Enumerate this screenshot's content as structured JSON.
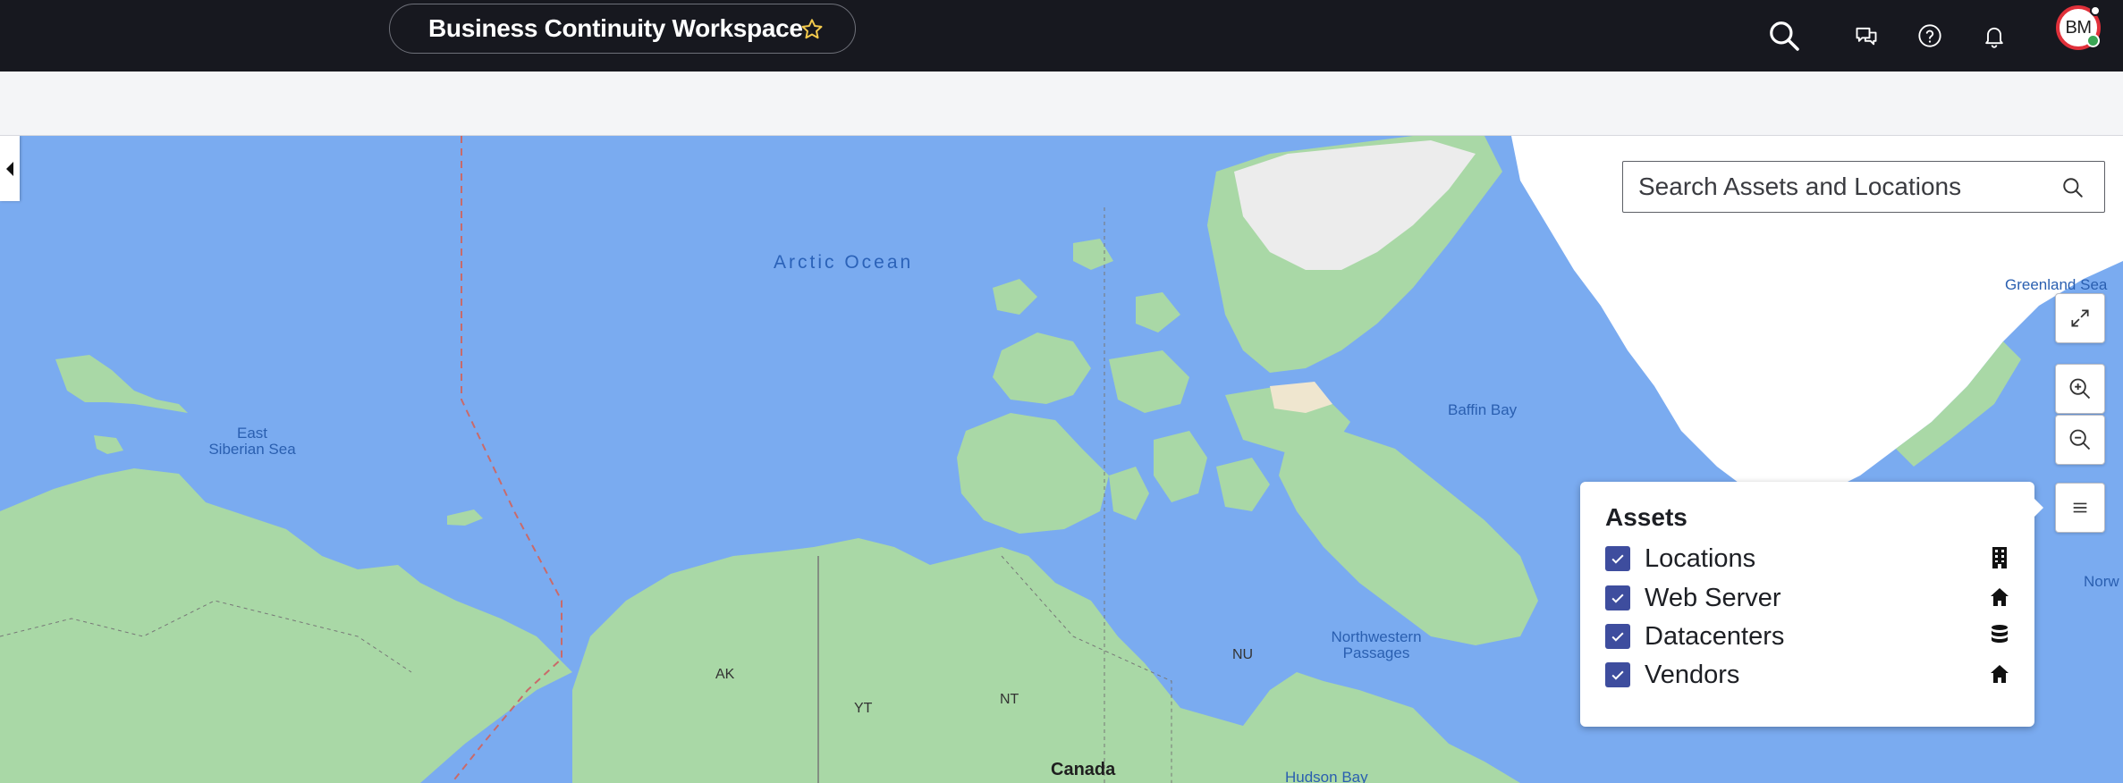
{
  "header": {
    "workspace_title": "Business Continuity Workspace",
    "avatar_initials": "BM",
    "icons": [
      "search-icon",
      "chat-icon",
      "help-icon",
      "bell-icon"
    ]
  },
  "map": {
    "search_placeholder": "Search Assets and Locations",
    "labels": {
      "arctic_ocean": "Arctic Ocean",
      "east_siberian_sea_1": "East",
      "east_siberian_sea_2": "Siberian Sea",
      "baffin_bay": "Baffin Bay",
      "greenland_sea": "Greenland Sea",
      "norw": "Norw",
      "northwestern_passages_1": "Northwestern",
      "northwestern_passages_2": "Passages",
      "hudson_bay": "Hudson Bay",
      "ak": "AK",
      "yt": "YT",
      "nt": "NT",
      "nu": "NU",
      "canada": "Canada"
    },
    "controls": [
      "expand-icon",
      "zoom-in-icon",
      "zoom-out-icon",
      "menu-icon"
    ]
  },
  "legend": {
    "title": "Assets",
    "items": [
      {
        "label": "Locations",
        "checked": true,
        "icon": "building-icon"
      },
      {
        "label": "Web Server",
        "checked": true,
        "icon": "house-icon"
      },
      {
        "label": "Datacenters",
        "checked": true,
        "icon": "database-icon"
      },
      {
        "label": "Vendors",
        "checked": true,
        "icon": "house-icon"
      }
    ]
  },
  "colors": {
    "topbar": "#17181f",
    "ocean": "#7aabf0",
    "land": "#a9d8a6",
    "ice": "#ffffff",
    "checkbox": "#3e4d9e",
    "avatar_ring": "#e0303a"
  }
}
